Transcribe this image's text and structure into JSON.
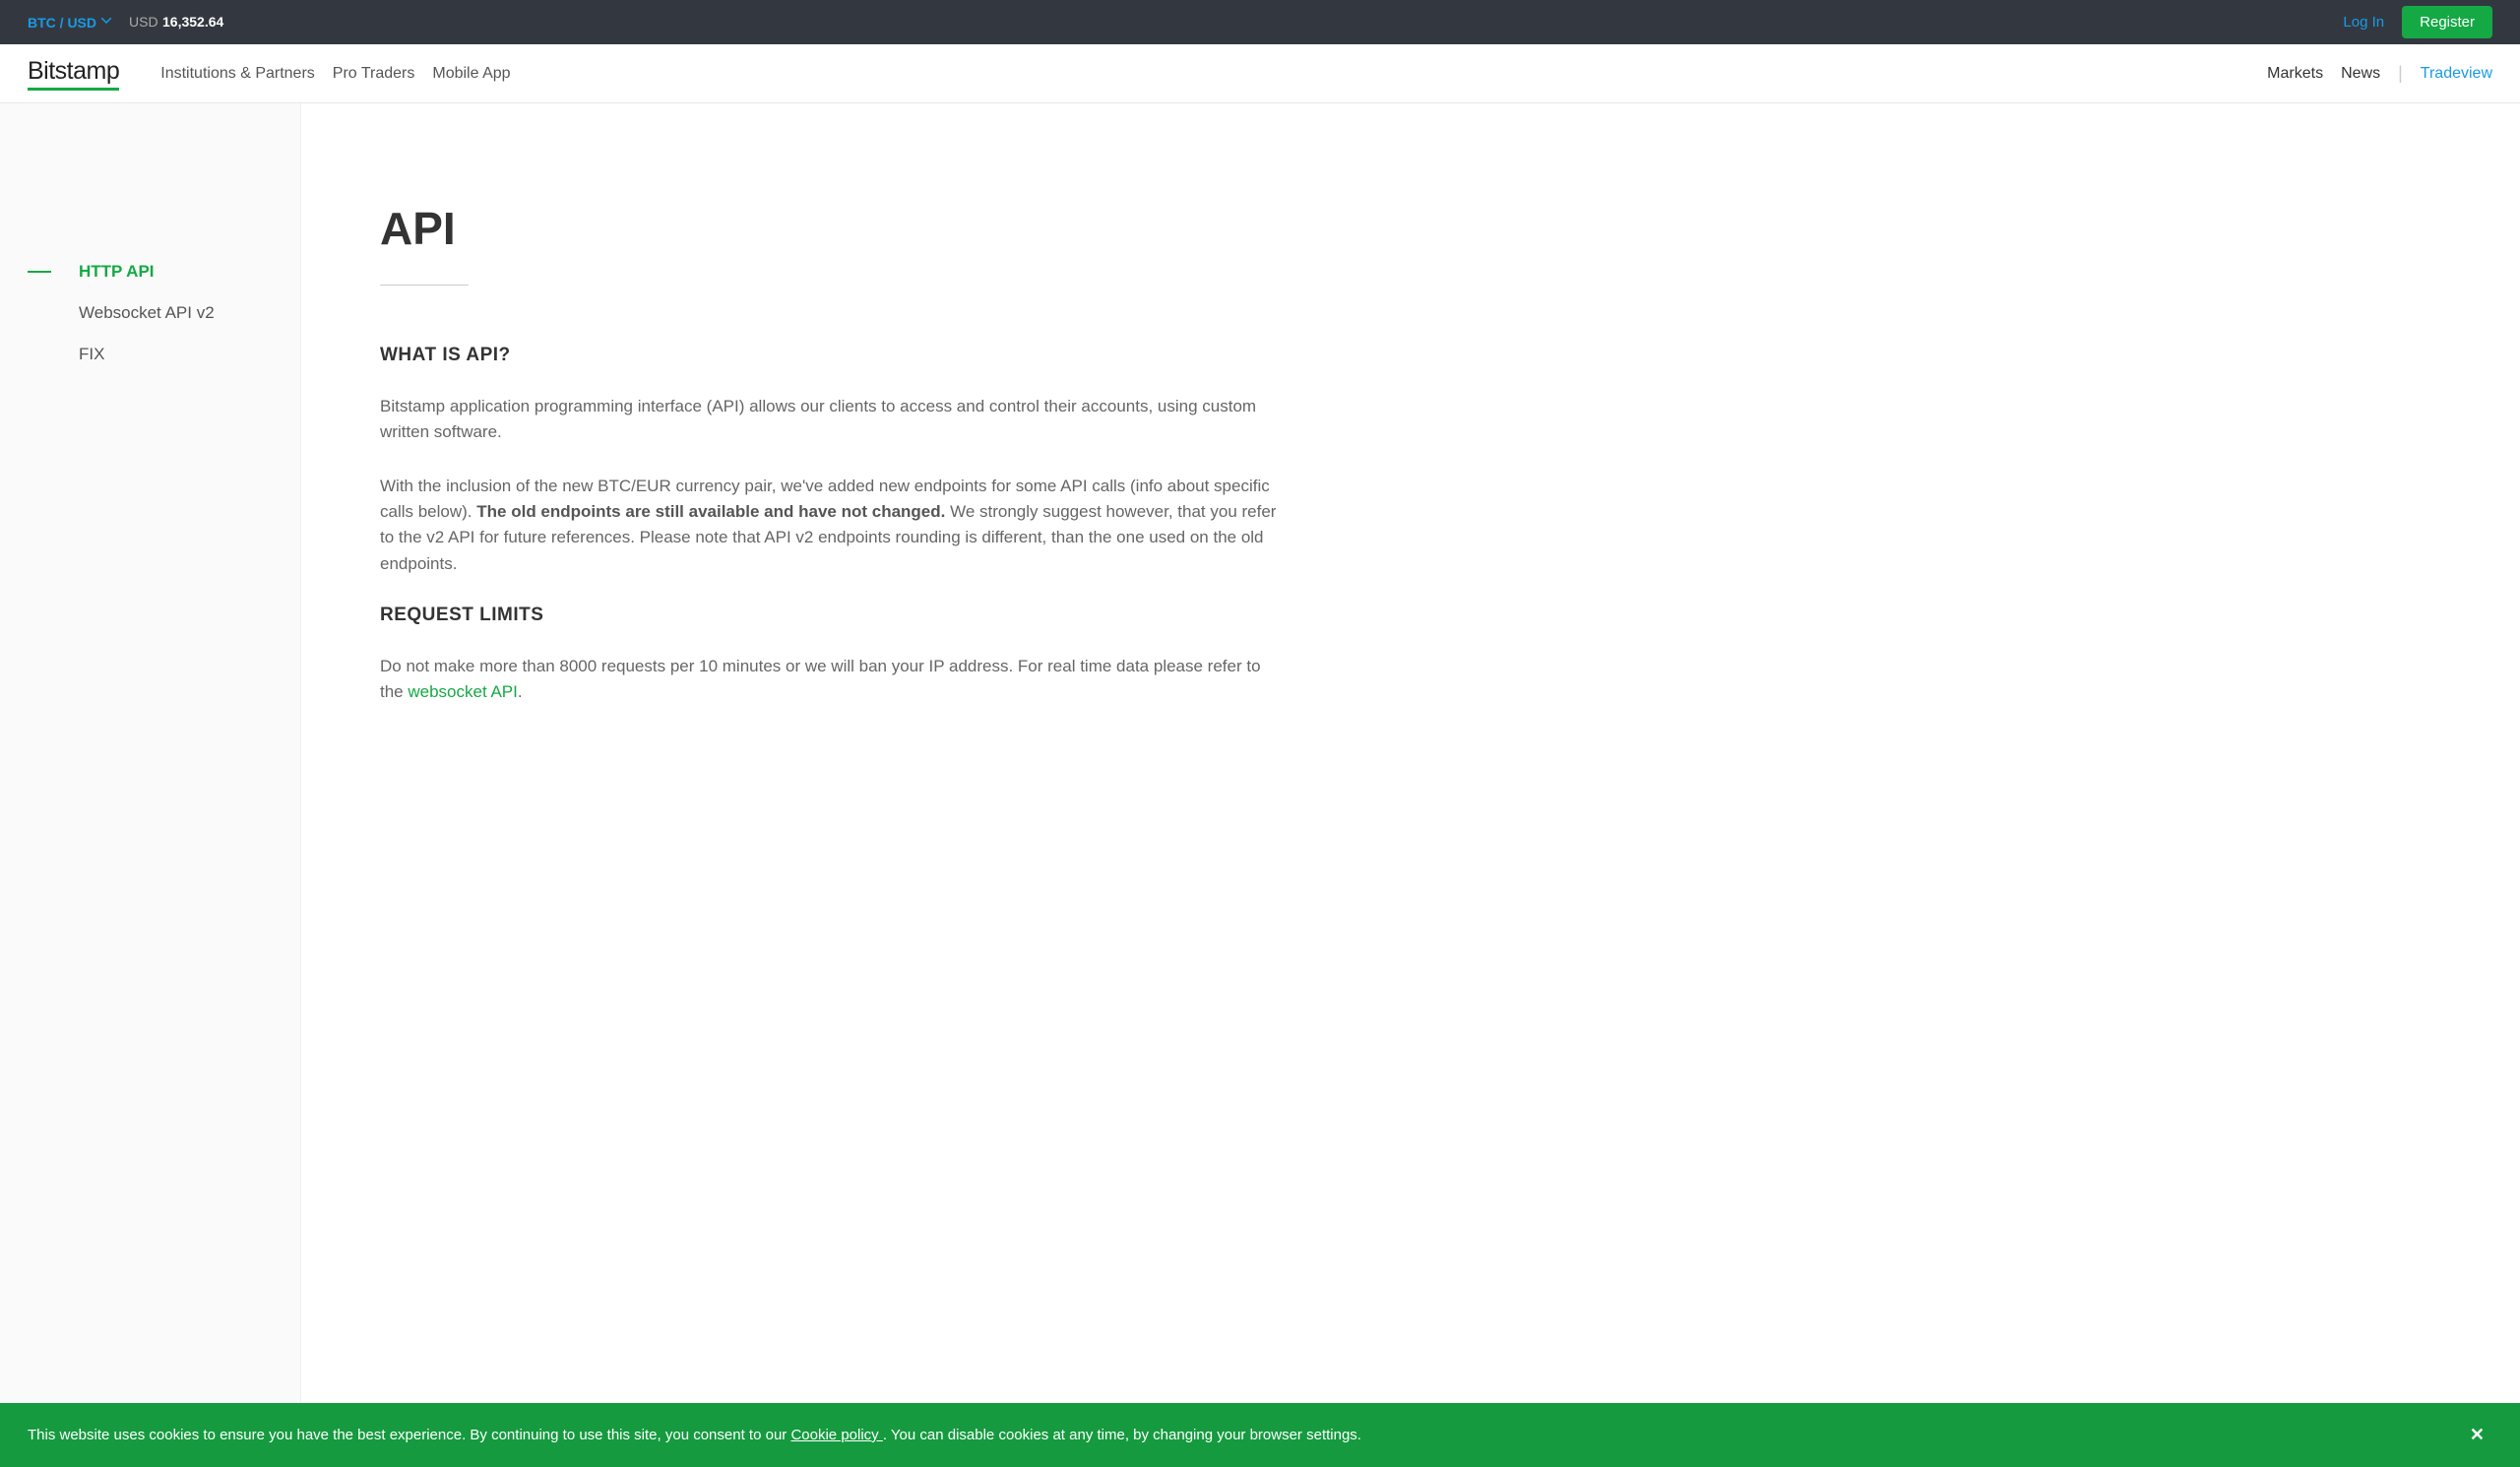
{
  "topbar": {
    "pair": "BTC / USD",
    "price_currency": "USD",
    "price_value": "16,352.64",
    "login": "Log In",
    "register": "Register"
  },
  "header": {
    "logo": "Bitstamp",
    "nav": [
      "Institutions & Partners",
      "Pro Traders",
      "Mobile App"
    ],
    "right": {
      "markets": "Markets",
      "news": "News",
      "tradeview": "Tradeview"
    }
  },
  "sidebar": {
    "items": [
      {
        "label": "HTTP API",
        "active": true
      },
      {
        "label": "Websocket API v2",
        "active": false
      },
      {
        "label": "FIX",
        "active": false
      }
    ]
  },
  "main": {
    "title": "API",
    "section1": {
      "heading": "WHAT IS API?",
      "p1": "Bitstamp application programming interface (API) allows our clients to access and control their accounts, using custom written software.",
      "p2a": "With the inclusion of the new BTC/EUR currency pair, we've added new endpoints for some API calls (info about specific calls below). ",
      "p2b_strong": "The old endpoints are still available and have not changed.",
      "p2c": " We strongly suggest however, that you refer to the v2 API for future references. Please note that API v2 endpoints rounding is different, than the one used on the old endpoints."
    },
    "section2": {
      "heading": "REQUEST LIMITS",
      "p1a": "Do not make more than 8000 requests per 10 minutes or we will ban your IP address. For real time data please refer to the ",
      "p1_link": "websocket API",
      "p1b": "."
    }
  },
  "cookie": {
    "text_a": "This website uses cookies to ensure you have the best experience. By continuing to use this site, you consent to our ",
    "link": "Cookie policy ",
    "text_b": ". You can disable cookies at any time, by changing your browser settings."
  }
}
